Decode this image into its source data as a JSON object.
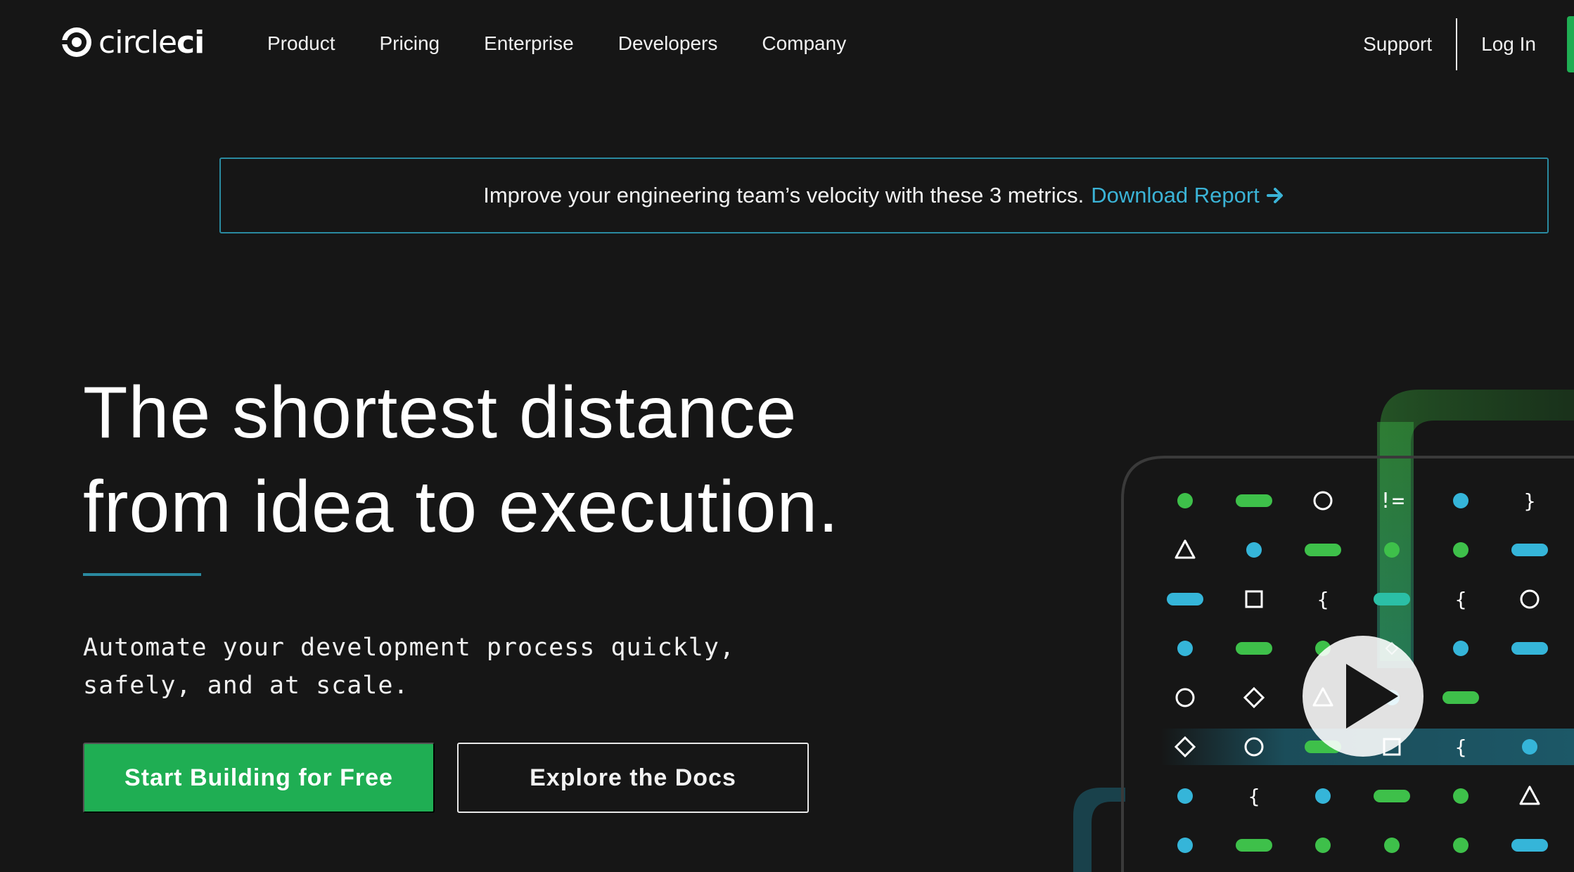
{
  "brand": {
    "name_light": "circle",
    "name_bold": "ci",
    "logo_icon": "circleci-logo-icon"
  },
  "nav": {
    "links": [
      "Product",
      "Pricing",
      "Enterprise",
      "Developers",
      "Company"
    ],
    "support": "Support",
    "login": "Log In"
  },
  "banner": {
    "text": "Improve your engineering team’s velocity with these 3 metrics.",
    "link": "Download Report",
    "arrow_icon": "arrow-right-icon"
  },
  "hero": {
    "title_line1": "The shortest distance",
    "title_line2": "from idea to execution.",
    "subtitle_line1": "Automate your development process quickly,",
    "subtitle_line2": "safely, and at scale.",
    "primary_cta": "Start Building for Free",
    "secondary_cta": "Explore the Docs"
  },
  "visual": {
    "play_icon": "play-icon",
    "grid": [
      [
        "dot-green",
        "pill-green",
        "circle",
        "neq",
        "dot-blue",
        "rbrace"
      ],
      [
        "triangle",
        "dot-blue",
        "pill-green",
        "dot-green",
        "dot-green",
        "pill-blue"
      ],
      [
        "pill-blue",
        "square",
        "lbrace",
        "pill-teal",
        "lbrace",
        "circle"
      ],
      [
        "dot-blue",
        "pill-green",
        "dot-green",
        "diamond-small",
        "dot-blue",
        "pill-blue-brace"
      ],
      [
        "circle",
        "diamond",
        "triangle",
        "dot-blue",
        "pill-green",
        "none"
      ],
      [
        "diamond",
        "circle",
        "pill-green",
        "square",
        "lbrace",
        "dot-blue"
      ],
      [
        "dot-blue",
        "lbrace",
        "dot-blue",
        "pill-green",
        "dot-green",
        "triangle"
      ],
      [
        "dot-blue",
        "pill-green",
        "dot-green",
        "dot-green",
        "dot-green",
        "pill-blue"
      ]
    ],
    "colors": {
      "green": "#3ec04a",
      "blue": "#35b5d9",
      "teal": "#2bbfa6"
    },
    "tokens": {
      "neq": "!=",
      "lbrace": "{",
      "rbrace": "}"
    }
  },
  "colors": {
    "background": "#161616",
    "accent_green": "#1fae53",
    "accent_blue": "#3bb3d6",
    "rule": "#2a8aa0"
  }
}
